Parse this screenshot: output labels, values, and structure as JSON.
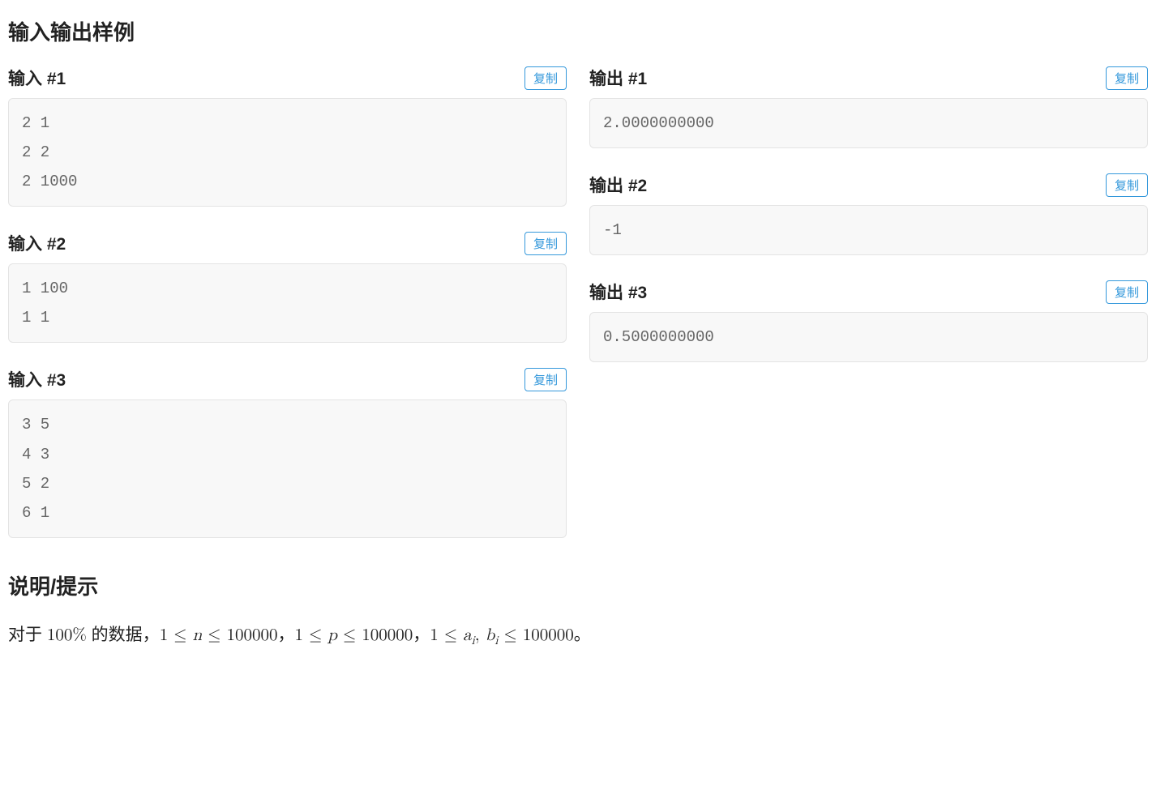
{
  "section_title": "输入输出样例",
  "copy_label": "复制",
  "samples": [
    {
      "input_title": "输入 #1",
      "input": "2 1\n2 2\n2 1000",
      "output_title": "输出 #1",
      "output": "2.0000000000"
    },
    {
      "input_title": "输入 #2",
      "input": "1 100\n1 1",
      "output_title": "输出 #2",
      "output": "-1"
    },
    {
      "input_title": "输入 #3",
      "input": "3 5\n4 3\n5 2\n6 1",
      "output_title": "输出 #3",
      "output": "0.5000000000"
    }
  ],
  "hint_title": "说明/提示",
  "hint": {
    "prefix": "对于 ",
    "pct": "100%",
    "mid": " 的数据，",
    "c1a": "1 ≤ ",
    "c1v": "n",
    "c1b": " ≤ 100000",
    "sep": "，",
    "c2a": "1 ≤ ",
    "c2v": "p",
    "c2b": " ≤ 100000",
    "c3a": "1 ≤ ",
    "c3v1": "a",
    "c3comma": ", ",
    "c3v2": "b",
    "c3b": " ≤ 100000",
    "sub": "i",
    "end": "。"
  }
}
